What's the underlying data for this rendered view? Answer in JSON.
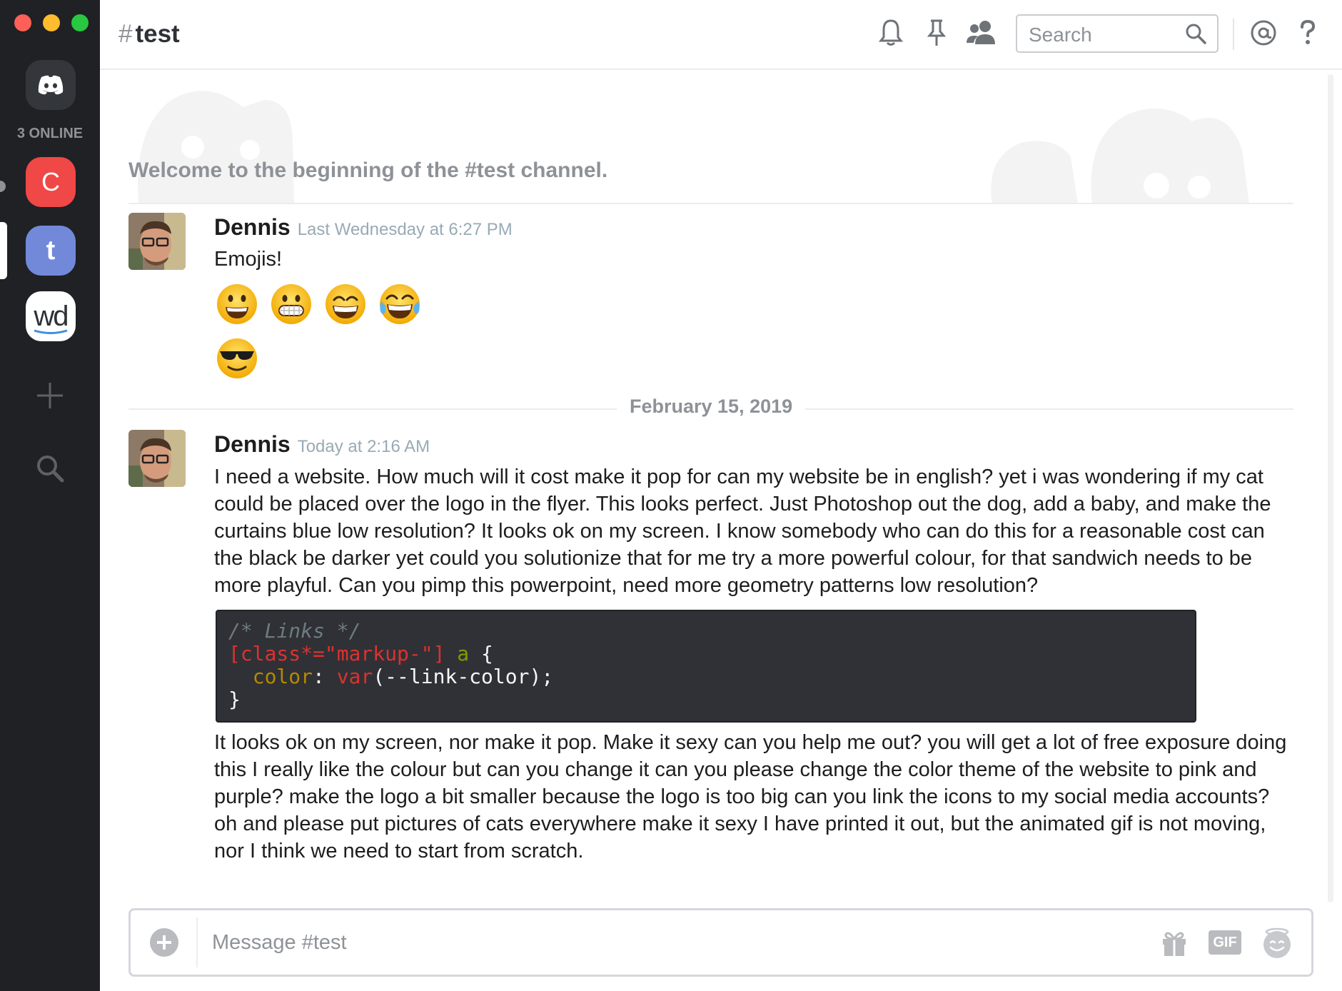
{
  "window": {
    "traffic_colors": [
      "#fe5f57",
      "#febc2e",
      "#28c840"
    ]
  },
  "rail": {
    "online_label": "3 ONLINE",
    "servers": [
      {
        "label": "C",
        "color": "#f04747"
      },
      {
        "label": "t",
        "color": "#7289da"
      },
      {
        "label": "wd",
        "color": "#ffffff"
      }
    ]
  },
  "header": {
    "hash": "#",
    "channel_name": "test",
    "search_placeholder": "Search",
    "icons": [
      "bell-icon",
      "pin-icon",
      "members-icon",
      "search-icon",
      "at-icon",
      "help-icon"
    ]
  },
  "welcome_text": "Welcome to the beginning of the #test channel.",
  "messages": [
    {
      "author": "Dennis",
      "timestamp": "Last Wednesday at 6:27 PM",
      "text": "Emojis!",
      "emojis": [
        "grinning-face",
        "grimacing-face",
        "beaming-face",
        "tears-of-joy-face",
        "sunglasses-face"
      ]
    },
    {
      "author": "Dennis",
      "timestamp": "Today at 2:16 AM",
      "text": "I need a website. How much will it cost make it pop for can my website be in english? yet i was wondering if my cat could be placed over the logo in the flyer. This looks perfect. Just Photoshop out the dog, add a baby, and make the curtains blue low resolution? It looks ok on my screen. I know somebody who can do this for a reasonable cost can the black be darker yet could you solutionize that for me try a more powerful colour, for that sandwich needs to be more playful. Can you pimp this powerpoint, need more geometry patterns low resolution?",
      "code": {
        "comment": "/* Links */",
        "selector": "[class*=\"markup-\"]",
        "element": "a",
        "open_brace": "{",
        "property": "color",
        "colon": ":",
        "function": "var",
        "argument": "(--link-color);",
        "close_brace": "}"
      },
      "text2": "It looks ok on my screen, nor make it pop. Make it sexy can you help me out? you will get a lot of free exposure doing this I really like the colour but can you change it can you please change the color theme of the website to pink and purple? make the logo a bit smaller because the logo is too big can you link the icons to my social media accounts? oh and please put pictures of cats everywhere make it sexy I have printed it out, but the animated gif is not moving, nor I think we need to start from scratch."
    }
  ],
  "date_divider": "February 15, 2019",
  "composer": {
    "placeholder": "Message #test",
    "gif_label": "GIF"
  }
}
